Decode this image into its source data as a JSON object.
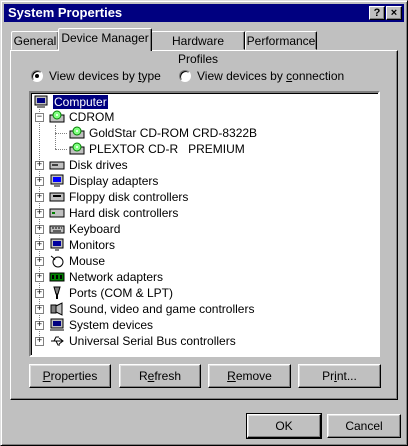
{
  "window": {
    "title": "System Properties",
    "help_label": "?",
    "close_label": "×"
  },
  "tabs": [
    {
      "label": "General"
    },
    {
      "label": "Device Manager"
    },
    {
      "label": "Hardware Profiles"
    },
    {
      "label": "Performance"
    }
  ],
  "view_options": {
    "by_type_pre": "View devices by ",
    "by_type_key": "t",
    "by_type_post": "ype",
    "by_connection_pre": "View devices by ",
    "by_connection_key": "c",
    "by_connection_post": "onnection",
    "selected": "by_type"
  },
  "tree": {
    "root": {
      "label": "Computer",
      "icon": "computer-icon"
    },
    "items": [
      {
        "label": "CDROM",
        "expanded": true,
        "icon": "cdrom-icon",
        "children": [
          {
            "label": "GoldStar CD-ROM CRD-8322B",
            "icon": "cdrom-icon"
          },
          {
            "label": "PLEXTOR CD-R   PREMIUM",
            "icon": "cdrom-icon"
          }
        ]
      },
      {
        "label": "Disk drives",
        "icon": "disk-drive-icon"
      },
      {
        "label": "Display adapters",
        "icon": "display-adapter-icon"
      },
      {
        "label": "Floppy disk controllers",
        "icon": "floppy-controller-icon"
      },
      {
        "label": "Hard disk controllers",
        "icon": "hard-disk-controller-icon"
      },
      {
        "label": "Keyboard",
        "icon": "keyboard-icon"
      },
      {
        "label": "Monitors",
        "icon": "monitor-icon"
      },
      {
        "label": "Mouse",
        "icon": "mouse-icon"
      },
      {
        "label": "Network adapters",
        "icon": "network-adapter-icon"
      },
      {
        "label": "Ports (COM & LPT)",
        "icon": "port-icon"
      },
      {
        "label": "Sound, video and game controllers",
        "icon": "sound-icon"
      },
      {
        "label": "System devices",
        "icon": "system-device-icon"
      },
      {
        "label": "Universal Serial Bus controllers",
        "icon": "usb-icon"
      }
    ]
  },
  "buttons": {
    "properties": {
      "key": "P",
      "rest": "roperties"
    },
    "refresh": {
      "pre": "R",
      "key": "e",
      "rest": "fresh"
    },
    "remove": {
      "pre": "",
      "key": "R",
      "rest": "emove"
    },
    "print": {
      "pre": "Pr",
      "key": "i",
      "rest": "nt..."
    },
    "ok": "OK",
    "cancel": "Cancel"
  },
  "colors": {
    "title_bar": "#000080",
    "selection": "#000080",
    "face": "#c0c0c0"
  }
}
